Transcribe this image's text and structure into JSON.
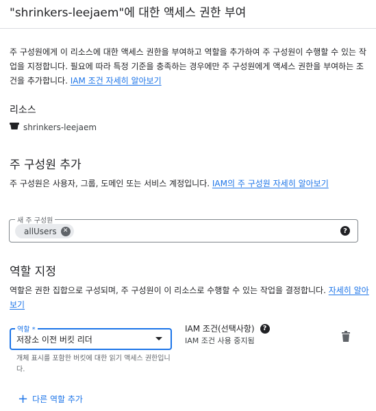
{
  "dialog": {
    "title": "\"shrinkers-leejaem\"에 대한 액세스 권한 부여",
    "intro_text": "주 구성원에게 이 리소스에 대한 액세스 권한을 부여하고 역할을 추가하여 주 구성원이 수행할 수 있는 작업을 지정합니다. 필요에 따라 특정 기준을 충족하는 경우에만 주 구성원에게 액세스 권한을 부여하는 조건을 추가합니다. ",
    "intro_link": "IAM 조건 자세히 알아보기"
  },
  "resource": {
    "label": "리소스",
    "name": "shrinkers-leejaem",
    "icon": "bucket-icon"
  },
  "principals": {
    "heading": "주 구성원 추가",
    "description": "주 구성원은 사용자, 그룹, 도메인 또는 서비스 계정입니다. ",
    "link": "IAM의 주 구성원 자세히 알아보기",
    "field_label": "새 주 구성원",
    "chips": [
      "allUsers"
    ]
  },
  "roles": {
    "heading": "역할 지정",
    "description": "역할은 권한 집합으로 구성되며, 주 구성원이 이 리소스로 수행할 수 있는 작업을 결정합니다. ",
    "link": "자세히 알아보기",
    "role_label": "역할 *",
    "role_value": "저장소 이전 버킷 리더",
    "role_hint": "개체 표시를 포함한 버킷에 대한 읽기 액세스 권한입니다.",
    "condition_title": "IAM 조건(선택사항)",
    "condition_sub": "IAM 조건 사용 중지됨",
    "add_role": "다른 역할 추가"
  },
  "colors": {
    "accent": "#1a73e8",
    "text": "#202124",
    "divider": "#dadce0"
  }
}
